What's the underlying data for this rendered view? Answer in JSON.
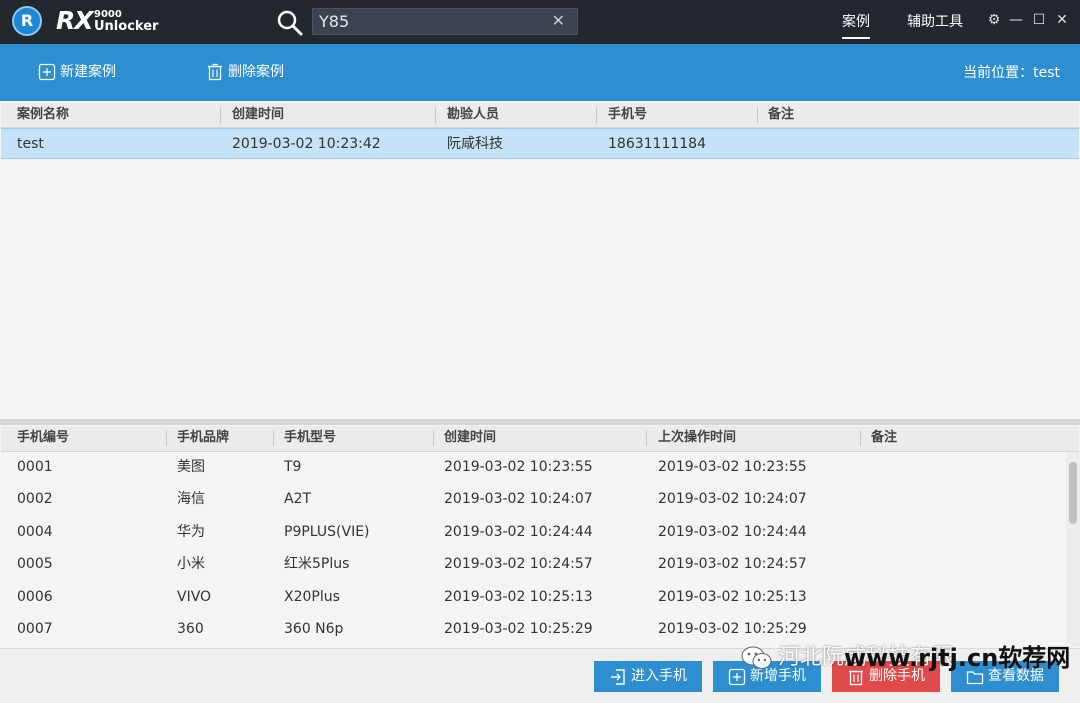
{
  "app": {
    "logo_letter": "R",
    "logo_rx": "RX",
    "logo_model": "9000",
    "logo_name": "Unlocker"
  },
  "search": {
    "value": "Y85",
    "clear_icon": "close-icon"
  },
  "nav": {
    "tabs": [
      {
        "label": "案例",
        "active": true
      },
      {
        "label": "辅助工具",
        "active": false
      }
    ]
  },
  "window_controls": {
    "settings": "⚙",
    "minimize": "—",
    "maximize": "☐",
    "close": "✕"
  },
  "toolbar": {
    "new_case": "新建案例",
    "delete_case": "删除案例",
    "location": "当前位置：test"
  },
  "case_table": {
    "headers": [
      "案例名称",
      "创建时间",
      "勘验人员",
      "手机号",
      "备注"
    ],
    "rows": [
      {
        "name": "test",
        "created": "2019-03-02 10:23:42",
        "inspector": "阮咸科技",
        "phone": "18631111184",
        "note": ""
      }
    ]
  },
  "phone_table": {
    "headers": [
      "手机编号",
      "手机品牌",
      "手机型号",
      "创建时间",
      "上次操作时间",
      "备注"
    ],
    "rows": [
      {
        "id": "0001",
        "brand": "美图",
        "model": "T9",
        "created": "2019-03-02 10:23:55",
        "last_op": "2019-03-02 10:23:55",
        "note": ""
      },
      {
        "id": "0002",
        "brand": "海信",
        "model": "A2T",
        "created": "2019-03-02 10:24:07",
        "last_op": "2019-03-02 10:24:07",
        "note": ""
      },
      {
        "id": "0004",
        "brand": "华为",
        "model": "P9PLUS(VIE)",
        "created": "2019-03-02 10:24:44",
        "last_op": "2019-03-02 10:24:44",
        "note": ""
      },
      {
        "id": "0005",
        "brand": "小米",
        "model": "红米5Plus",
        "created": "2019-03-02 10:24:57",
        "last_op": "2019-03-02 10:24:57",
        "note": ""
      },
      {
        "id": "0006",
        "brand": "VIVO",
        "model": "X20Plus",
        "created": "2019-03-02 10:25:13",
        "last_op": "2019-03-02 10:25:13",
        "note": ""
      },
      {
        "id": "0007",
        "brand": "360",
        "model": "360 N6p",
        "created": "2019-03-02 10:25:29",
        "last_op": "2019-03-02 10:25:29",
        "note": ""
      }
    ]
  },
  "actions": {
    "enter_phone": "进入手机",
    "add_phone": "新增手机",
    "delete_phone": "删除手机",
    "view_data": "查看数据"
  },
  "watermark": {
    "text": "河北阮咸科技有限",
    "site": "www.rjtj.cn软荐网"
  },
  "colors": {
    "titlebar": "#23272e",
    "accent": "#2d8fd0",
    "selected_row": "#c5e2f8",
    "danger": "#e04a4a"
  }
}
